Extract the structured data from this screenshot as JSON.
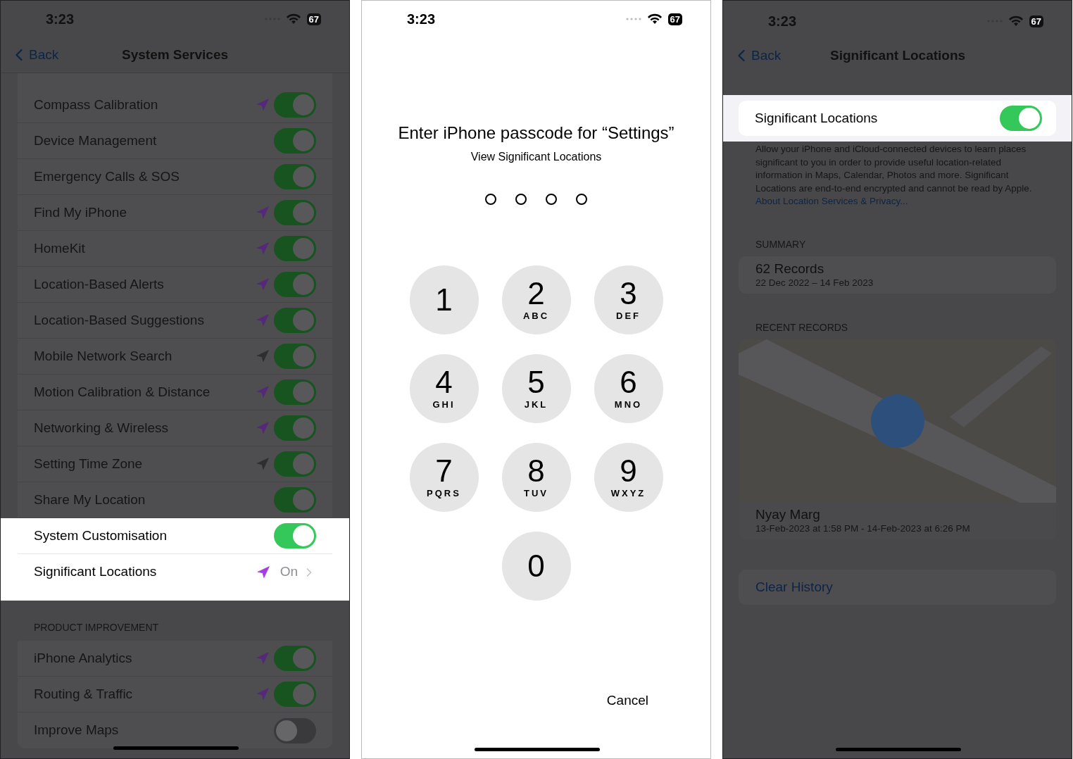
{
  "system_services": {
    "status_bar": {
      "time": "3:23",
      "battery": "67"
    },
    "nav": {
      "back": "Back",
      "title": "System Services"
    },
    "sections": [
      {
        "rows": [
          {
            "kind": "toggle",
            "label": "Compass Calibration",
            "on": true,
            "location_used": true,
            "recent": true,
            "highlighted": false
          },
          {
            "kind": "toggle",
            "label": "Device Management",
            "on": true,
            "location_used": false,
            "highlighted": false
          },
          {
            "kind": "toggle",
            "label": "Emergency Calls & SOS",
            "on": true,
            "location_used": false,
            "highlighted": false
          },
          {
            "kind": "toggle",
            "label": "Find My iPhone",
            "on": true,
            "location_used": true,
            "recent": true,
            "highlighted": false
          },
          {
            "kind": "toggle",
            "label": "HomeKit",
            "on": true,
            "location_used": true,
            "recent": true,
            "highlighted": false
          },
          {
            "kind": "toggle",
            "label": "Location-Based Alerts",
            "on": true,
            "location_used": true,
            "recent": true,
            "highlighted": false
          },
          {
            "kind": "toggle",
            "label": "Location-Based Suggestions",
            "on": true,
            "location_used": true,
            "recent": true,
            "highlighted": false
          },
          {
            "kind": "toggle",
            "label": "Mobile Network Search",
            "on": true,
            "location_used": true,
            "recent": false,
            "highlighted": false
          },
          {
            "kind": "toggle",
            "label": "Motion Calibration & Distance",
            "on": true,
            "location_used": true,
            "recent": true,
            "highlighted": false
          },
          {
            "kind": "toggle",
            "label": "Networking & Wireless",
            "on": true,
            "location_used": true,
            "recent": true,
            "highlighted": false
          },
          {
            "kind": "toggle",
            "label": "Setting Time Zone",
            "on": true,
            "location_used": true,
            "recent": false,
            "highlighted": false
          },
          {
            "kind": "toggle",
            "label": "Share My Location",
            "on": true,
            "location_used": false,
            "highlighted": false
          },
          {
            "kind": "toggle",
            "label": "System Customisation",
            "on": true,
            "location_used": false,
            "highlighted": true
          },
          {
            "kind": "link",
            "label": "Significant Locations",
            "value": "On",
            "location_used": true,
            "recent": true,
            "highlighted": true
          }
        ]
      },
      {
        "header": "PRODUCT IMPROVEMENT",
        "rows": [
          {
            "kind": "toggle",
            "label": "iPhone Analytics",
            "on": true,
            "location_used": true,
            "recent": true,
            "highlighted": false
          },
          {
            "kind": "toggle",
            "label": "Routing & Traffic",
            "on": true,
            "location_used": true,
            "recent": true,
            "highlighted": false
          },
          {
            "kind": "toggle",
            "label": "Improve Maps",
            "on": false,
            "location_used": false,
            "highlighted": false
          }
        ]
      }
    ]
  },
  "passcode": {
    "status_bar": {
      "time": "3:23",
      "battery": "67"
    },
    "title": "Enter iPhone passcode for “Settings”",
    "subtitle": "View Significant Locations",
    "dots": [
      {
        "filled": false
      },
      {
        "filled": false
      },
      {
        "filled": false
      },
      {
        "filled": false
      }
    ],
    "keys": [
      {
        "digit": "1"
      },
      {
        "digit": "2",
        "letters": "ABC"
      },
      {
        "digit": "3",
        "letters": "DEF"
      },
      {
        "digit": "4",
        "letters": "GHI"
      },
      {
        "digit": "5",
        "letters": "JKL"
      },
      {
        "digit": "6",
        "letters": "MNO"
      },
      {
        "digit": "7",
        "letters": "PQRS"
      },
      {
        "digit": "8",
        "letters": "TUV"
      },
      {
        "digit": "9",
        "letters": "WXYZ"
      },
      {
        "digit": "0"
      }
    ],
    "cancel": "Cancel"
  },
  "significant_locations": {
    "status_bar": {
      "time": "3:23",
      "battery": "67"
    },
    "nav": {
      "back": "Back",
      "title": "Significant Locations"
    },
    "toggle": {
      "label": "Significant Locations",
      "on": true
    },
    "description": "Allow your iPhone and iCloud-connected devices to learn places significant to you in order to provide useful location-related information in Maps, Calendar, Photos and more. Significant Locations are end-to-end encrypted and cannot be read by Apple.",
    "link": "About Location Services & Privacy...",
    "summary": {
      "header": "SUMMARY",
      "title": "62 Records",
      "subtitle": "22 Dec 2022 – 14 Feb 2023"
    },
    "recent": {
      "header": "RECENT RECORDS",
      "title": "Nyay Marg",
      "subtitle": "13-Feb-2023 at 1:58 PM - 14-Feb-2023 at 6:26 PM"
    },
    "clear": "Clear History"
  }
}
